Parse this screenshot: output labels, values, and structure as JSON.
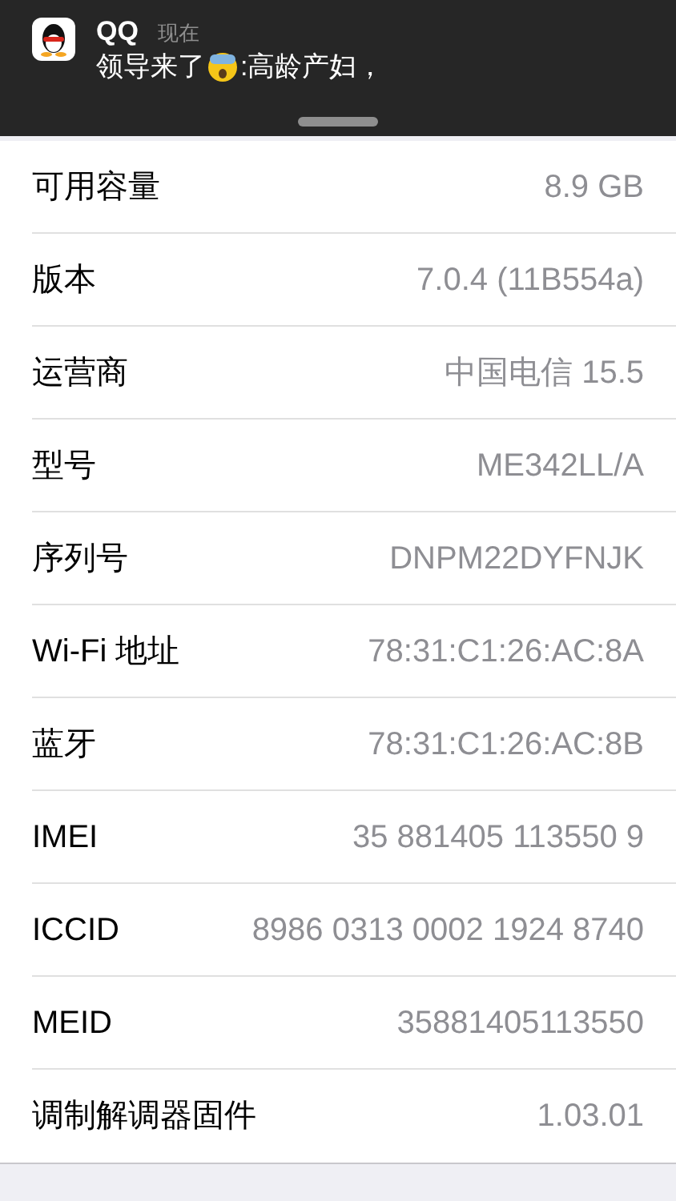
{
  "notification": {
    "app": "QQ",
    "time": "现在",
    "message_before": "领导来了",
    "message_after": ":高龄产妇，"
  },
  "rows": [
    {
      "label": "可用容量",
      "value": "8.9 GB"
    },
    {
      "label": "版本",
      "value": "7.0.4 (11B554a)"
    },
    {
      "label": "运营商",
      "value": "中国电信 15.5"
    },
    {
      "label": "型号",
      "value": "ME342LL/A"
    },
    {
      "label": "序列号",
      "value": "DNPM22DYFNJK"
    },
    {
      "label": "Wi-Fi 地址",
      "value": "78:31:C1:26:AC:8A"
    },
    {
      "label": "蓝牙",
      "value": "78:31:C1:26:AC:8B"
    },
    {
      "label": "IMEI",
      "value": "35 881405 113550 9"
    },
    {
      "label": "ICCID",
      "value": "8986 0313 0002 1924 8740"
    },
    {
      "label": "MEID",
      "value": "35881405113550"
    },
    {
      "label": "调制解调器固件",
      "value": "1.03.01"
    }
  ]
}
